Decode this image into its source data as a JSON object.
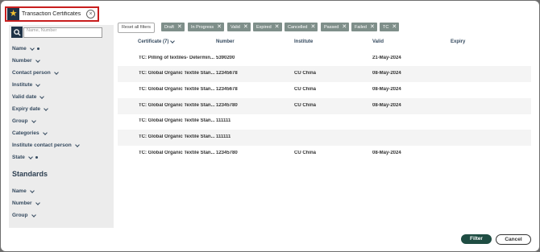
{
  "saved_search": {
    "value": "Transaction Certificates"
  },
  "sidebar": {
    "search_placeholder": "Name, Number",
    "filters": [
      "Name",
      "Number",
      "Contact person",
      "Institute",
      "Valid date",
      "Expiry date",
      "Group",
      "Categories",
      "Institute contact person",
      "State"
    ],
    "standards_heading": "Standards",
    "standards_filters": [
      "Name",
      "Number",
      "Group"
    ]
  },
  "chips": {
    "reset_label": "Reset all filters",
    "items": [
      "Draft",
      "In Progress",
      "Valid",
      "Expired",
      "Cancelled",
      "Passed",
      "Failed",
      "TC"
    ]
  },
  "table": {
    "headers": [
      "Certificate (7)",
      "Number",
      "Institute",
      "Valid",
      "Expiry"
    ],
    "rows": [
      [
        "TC: Pilling of textiles- Determin...",
        "5390200",
        "",
        "21-May-2024",
        ""
      ],
      [
        "TC: Global Organic Textile Stan...",
        "12345678",
        "CU China",
        "08-May-2024",
        ""
      ],
      [
        "TC: Global Organic Textile Stan...",
        "12345678",
        "CU China",
        "08-May-2024",
        ""
      ],
      [
        "TC: Global Organic Textile Stan...",
        "12345780",
        "CU China",
        "08-May-2024",
        ""
      ],
      [
        "TC: Global Organic Textile Stan...",
        "111111",
        "",
        "",
        ""
      ],
      [
        "TC: Global Organic Textile Stan...",
        "111111",
        "",
        "",
        ""
      ],
      [
        "TC: Global Organic Textile Stan...",
        "12345780",
        "CU China",
        "08-May-2024",
        ""
      ]
    ]
  },
  "footer": {
    "filter_label": "Filter",
    "cancel_label": "Cancel"
  }
}
